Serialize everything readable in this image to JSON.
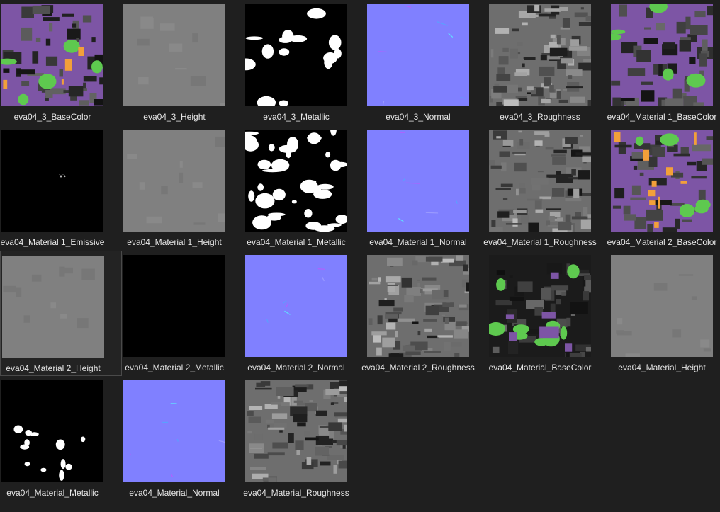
{
  "files": [
    {
      "name": "eva04_3_BaseColor",
      "kind": "basecolor-a"
    },
    {
      "name": "eva04_3_Height",
      "kind": "height"
    },
    {
      "name": "eva04_3_Metallic",
      "kind": "metallic-a"
    },
    {
      "name": "eva04_3_Normal",
      "kind": "normal"
    },
    {
      "name": "eva04_3_Roughness",
      "kind": "roughness"
    },
    {
      "name": "eva04_Material 1_BaseColor",
      "kind": "basecolor-b"
    },
    {
      "name": "eva04_Material 1_Emissive",
      "kind": "emissive"
    },
    {
      "name": "eva04_Material 1_Height",
      "kind": "height"
    },
    {
      "name": "eva04_Material 1_Metallic",
      "kind": "metallic-b"
    },
    {
      "name": "eva04_Material 1_Normal",
      "kind": "normal"
    },
    {
      "name": "eva04_Material 1_Roughness",
      "kind": "roughness"
    },
    {
      "name": "eva04_Material 2_BaseColor",
      "kind": "basecolor-c"
    },
    {
      "name": "eva04_Material 2_Height",
      "kind": "height",
      "selected": true
    },
    {
      "name": "eva04_Material 2_Metallic",
      "kind": "black"
    },
    {
      "name": "eva04_Material 2_Normal",
      "kind": "normal"
    },
    {
      "name": "eva04_Material 2_Roughness",
      "kind": "roughness"
    },
    {
      "name": "eva04_Material_BaseColor",
      "kind": "basecolor-d"
    },
    {
      "name": "eva04_Material_Height",
      "kind": "height"
    },
    {
      "name": "eva04_Material_Metallic",
      "kind": "metallic-c"
    },
    {
      "name": "eva04_Material_Normal",
      "kind": "normal"
    },
    {
      "name": "eva04_Material_Roughness",
      "kind": "roughness"
    }
  ],
  "colors": {
    "background": "#1f1f1f",
    "label": "#e6e6e6",
    "normal": "#8080ff",
    "height": "#808080",
    "purple": "#7d55a5",
    "green": "#5ec94f",
    "orange": "#f2a03a"
  }
}
